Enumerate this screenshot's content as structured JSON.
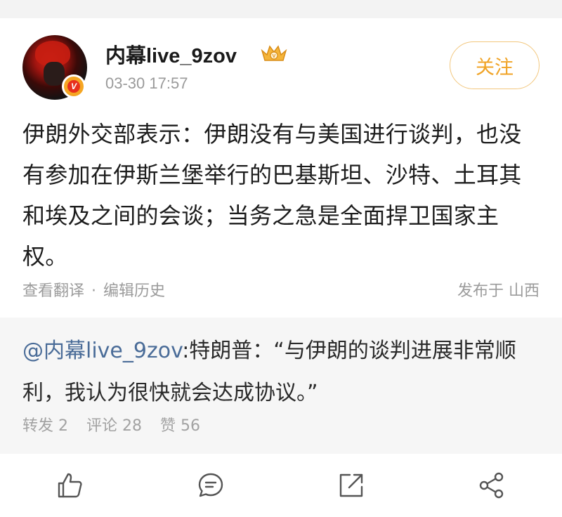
{
  "author": {
    "name": "内幕live_9zov",
    "timestamp": "03-30 17:57",
    "verified_badge": "V",
    "avatar_icon": "avatar-red-hair",
    "level_icon": "crown-icon"
  },
  "follow_button": {
    "label": "关注"
  },
  "post": {
    "text": "伊朗外交部表示：伊朗没有与美国进行谈判，也没有参加在伊斯兰堡举行的巴基斯坦、沙特、土耳其和埃及之间的会谈；当务之急是全面捍卫国家主权。"
  },
  "meta": {
    "translate": "查看翻译",
    "separator": "·",
    "edit_history": "编辑历史",
    "location": "发布于 山西"
  },
  "repost": {
    "mention": "@内幕live_9zov",
    "text": ":特朗普：“与伊朗的谈判进展非常顺利，我认为很快就会达成协议。”",
    "stats": {
      "forward": "转发 2",
      "comment": "评论 28",
      "like": "赞 56"
    }
  },
  "actions": {
    "like_icon": "thumbs-up-icon",
    "comment_icon": "comment-icon",
    "forward_icon": "forward-icon",
    "share_icon": "share-icon"
  },
  "colors": {
    "accent": "#f0a325",
    "link": "#4a6c98",
    "muted": "#9b9b9b",
    "repost_bg": "#f6f6f6"
  }
}
